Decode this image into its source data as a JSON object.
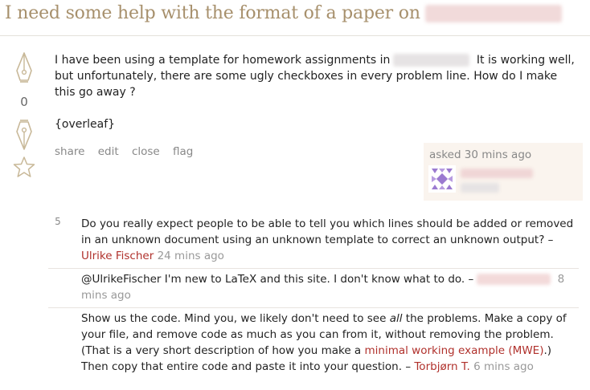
{
  "question": {
    "title": "I need some help with the format of a paper on",
    "score": "0",
    "body_part1": "I have been using a template for homework assignments in",
    "body_part2": "It is working well, but unfortunately, there are some ugly checkboxes in every problem line. How do I make this go away ?",
    "tag": "{overleaf}",
    "menu": [
      "share",
      "edit",
      "close",
      "flag"
    ],
    "asked": "asked 30 mins ago"
  },
  "comments": [
    {
      "score": "5",
      "text": "Do you really expect people to be able to tell you which lines should be added or removed in an unknown document using an unknown template to correct an unknown output?",
      "dash": "–",
      "user": "Ulrike Fischer",
      "time": "24 mins ago"
    },
    {
      "score": "",
      "text": "@UlrikeFischer I'm new to LaTeX and this site. I don't know what to do. –",
      "time": "8 mins ago"
    },
    {
      "score": "",
      "text_a": "Show us the code. Mind you, we likely don't need to see ",
      "text_em": "all",
      "text_b": " the problems. Make a copy of your file, and remove code as much as you can from it, without removing the problem. (That is a very short description of how you make a ",
      "link": "minimal working example (MWE)",
      "text_c": ".) Then copy that entire code and paste it into your question.",
      "dash": "–",
      "user": "Torbjørn T.",
      "time": "6 mins ago"
    }
  ],
  "colors": {
    "title": "#a7906c",
    "user_link": "#b0312c",
    "owner_bg": "#faf4ee",
    "vote_icon": "#c8b898"
  }
}
